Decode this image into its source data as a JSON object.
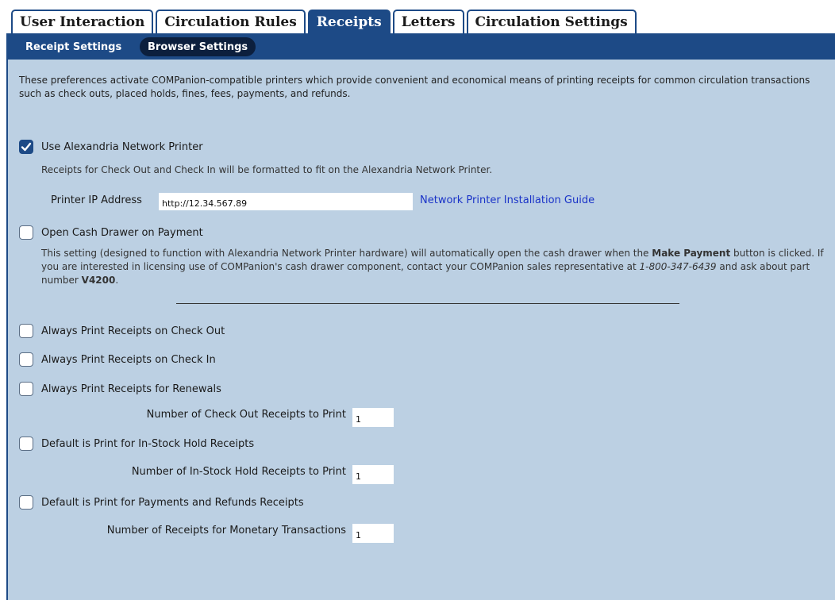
{
  "tabs": [
    "User Interaction",
    "Circulation Rules",
    "Receipts",
    "Letters",
    "Circulation Settings"
  ],
  "active_tab": "Receipts",
  "subtabs": [
    "Receipt Settings",
    "Browser Settings"
  ],
  "intro": "These preferences activate COMPanion-compatible printers which provide convenient and economical means of printing receipts for common circulation transactions such as check outs, placed holds, fines, fees, payments, and refunds.",
  "network_printer": {
    "label": "Use Alexandria Network Printer",
    "checked": true,
    "description": "Receipts for Check Out and Check In will be formatted to fit on the Alexandria Network Printer.",
    "ip_label": "Printer IP Address",
    "ip_value": "http://12.34.567.89",
    "guide_link": "Network Printer Installation Guide"
  },
  "cash_drawer": {
    "label": "Open Cash Drawer on Payment",
    "checked": false,
    "desc_1": "This setting (designed to function with Alexandria Network Printer hardware) will automatically open the cash drawer when the ",
    "desc_bold_1": "Make Payment",
    "desc_2": " button is clicked. If you are interested in licensing use of COMPanion's cash drawer component, contact your COMPanion sales representative at ",
    "desc_phone": "1-800-347-6439",
    "desc_3": " and ask about part number ",
    "desc_bold_2": "V4200",
    "desc_4": "."
  },
  "options": {
    "print_checkout": "Always Print Receipts on Check Out",
    "print_checkin": "Always Print Receipts on Check In",
    "print_renewals": "Always Print Receipts for Renewals",
    "checkout_count_label": "Number of Check Out Receipts to Print",
    "checkout_count": "1",
    "hold_default": "Default is Print for In-Stock Hold Receipts",
    "hold_count_label": "Number of In-Stock Hold Receipts to Print",
    "hold_count": "1",
    "payments_default": "Default is Print for Payments and Refunds Receipts",
    "monetary_count_label": "Number of Receipts for Monetary Transactions",
    "monetary_count": "1"
  },
  "colors": {
    "nav": "#1d4a86",
    "panel": "#bcd0e3",
    "link": "#1a33c8"
  }
}
